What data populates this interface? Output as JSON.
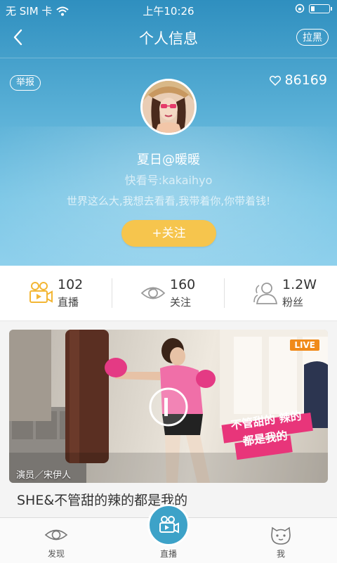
{
  "status_bar": {
    "carrier": "无 SIM 卡",
    "time": "上午10:26"
  },
  "nav": {
    "title": "个人信息",
    "block_label": "拉黑"
  },
  "profile": {
    "report_label": "举报",
    "likes": "86169",
    "nickname": "夏日@暖暖",
    "kk_id": "快看号:kakaihyo",
    "bio": "世界这么大,我想去看看,我带着你,你带着钱!",
    "follow_label": "+关注"
  },
  "stats": [
    {
      "icon": "video-camera-icon",
      "number": "102",
      "label": "直播"
    },
    {
      "icon": "eye-icon",
      "number": "160",
      "label": "关注"
    },
    {
      "icon": "fans-icon",
      "number": "1.2W",
      "label": "粉丝"
    }
  ],
  "video_card": {
    "live_badge": "LIVE",
    "actor": "演员／宋伊人",
    "overlay_text_line1": "不管甜的 辣的",
    "overlay_text_line2": "都是我的",
    "title": "SHE&不管甜的辣的都是我的"
  },
  "tabbar": {
    "items": [
      {
        "icon": "eye-icon",
        "label": "发现"
      },
      {
        "icon": "video-camera-icon",
        "label": "直播"
      },
      {
        "icon": "face-icon",
        "label": "我"
      }
    ]
  },
  "colors": {
    "header_top": "#2f8fbf",
    "header_bottom": "#8fd0ec",
    "follow_button": "#f6c54d",
    "stat_icon_yellow": "#f3b634",
    "live_orange": "#f08a1a",
    "tab_center": "#3da2c8",
    "overlay_pink": "#e8357a"
  }
}
